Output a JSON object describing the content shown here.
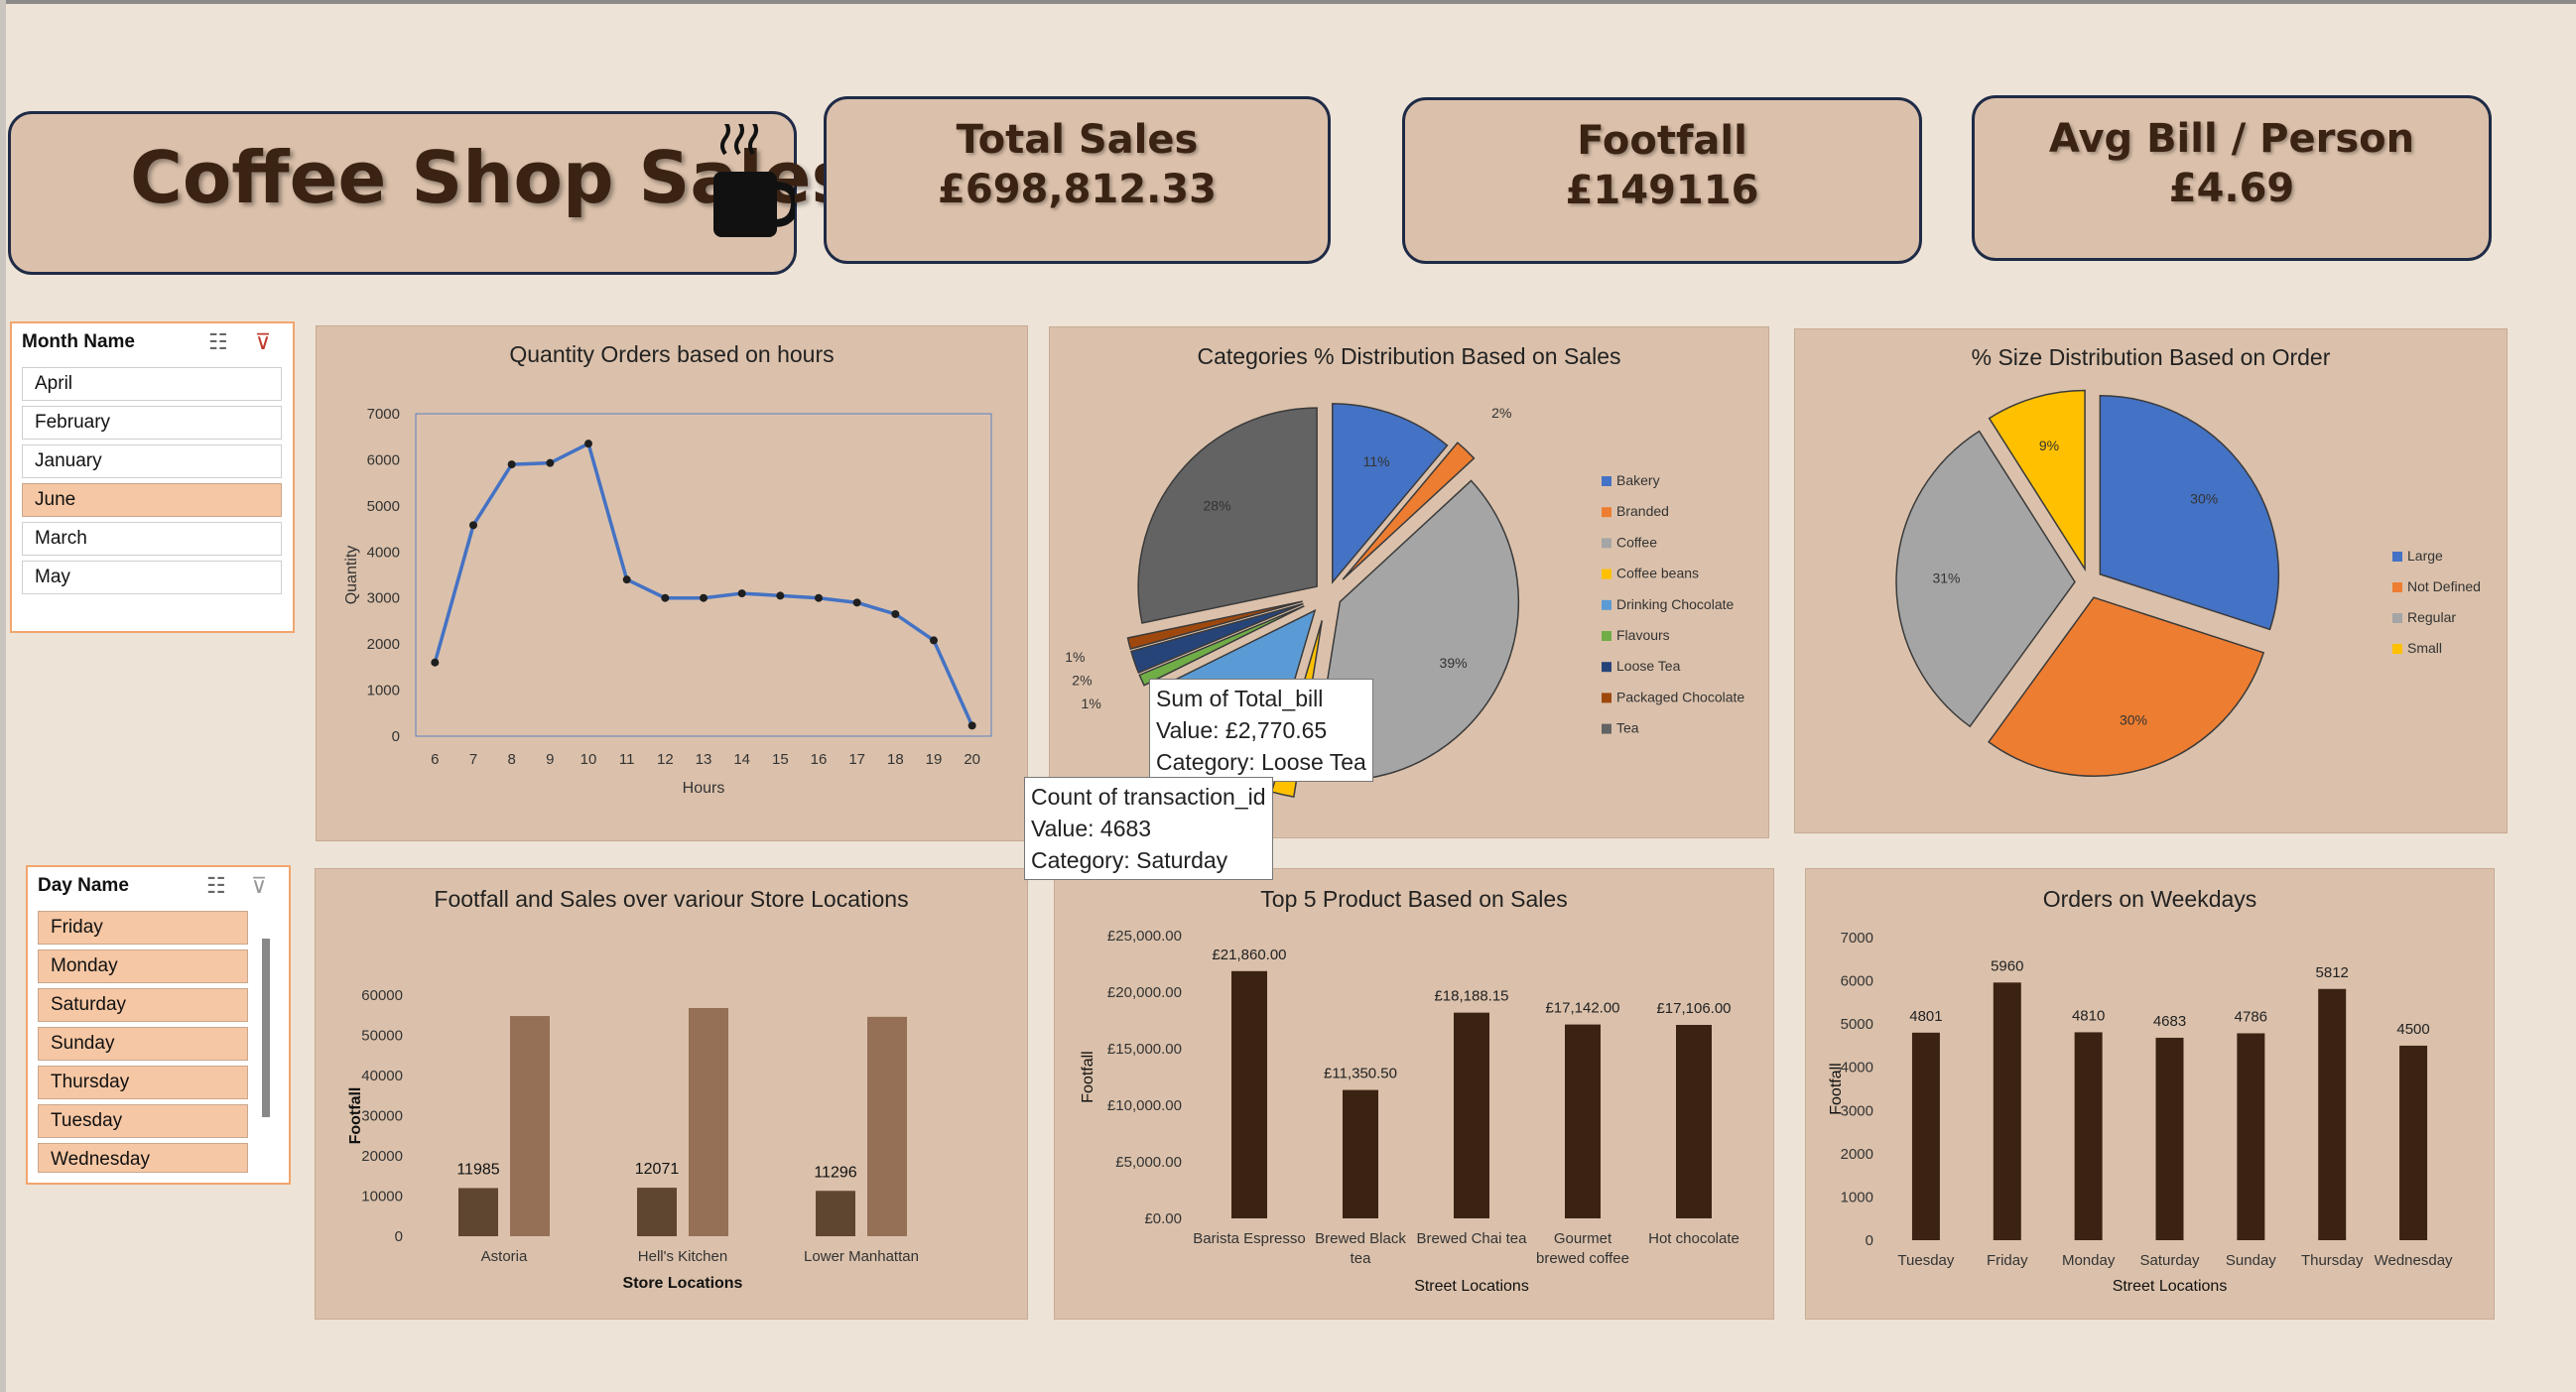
{
  "header": {
    "title": "Coffee Shop Sales",
    "kpis": [
      {
        "label": "Total Sales",
        "value": "£698,812.33"
      },
      {
        "label": "Footfall",
        "value": "£149116"
      },
      {
        "label": "Avg Bill / Person",
        "value": "£4.69"
      }
    ]
  },
  "slicers": {
    "month": {
      "title": "Month Name",
      "items": [
        "April",
        "February",
        "January",
        "June",
        "March",
        "May"
      ],
      "selected": "June"
    },
    "day": {
      "title": "Day Name",
      "items": [
        "Friday",
        "Monday",
        "Saturday",
        "Sunday",
        "Thursday",
        "Tuesday",
        "Wednesday"
      ]
    }
  },
  "tooltips": [
    {
      "lines": [
        "Sum of Total_bill",
        "Value: £2,770.65",
        "Category: Loose Tea"
      ]
    },
    {
      "lines": [
        "Count of transaction_id",
        "Value: 4683",
        "Category: Saturday"
      ]
    }
  ],
  "colors": {
    "background": "#ede3d7",
    "card": "#dbc1ab",
    "accent_dark": "#3b2314",
    "line": "#4472c4",
    "bar_dark": "#3b2314",
    "bar_mid": "#5f4630",
    "bar_light": "#957056"
  },
  "chart_data": [
    {
      "type": "line",
      "title": "Quantity Orders based on hours",
      "xlabel": "Hours",
      "ylabel": "Quantity",
      "x": [
        6,
        7,
        8,
        9,
        10,
        11,
        12,
        13,
        14,
        15,
        16,
        17,
        18,
        19,
        20
      ],
      "values": [
        1600,
        4580,
        5900,
        5930,
        6350,
        3400,
        3000,
        3000,
        3100,
        3050,
        3000,
        2900,
        2650,
        2080,
        230
      ],
      "ylim": [
        0,
        7000
      ],
      "yticks": [
        "0",
        "1000",
        "2000",
        "3000",
        "4000",
        "5000",
        "6000",
        "7000"
      ]
    },
    {
      "type": "pie",
      "title": "Categories % Distribution Based on Sales",
      "categories": [
        "Bakery",
        "Branded",
        "Coffee",
        "Coffee beans",
        "Drinking Chocolate",
        "Flavours",
        "Loose Tea",
        "Packaged Chocolate",
        "Tea"
      ],
      "values": [
        11,
        2,
        39,
        2,
        13,
        1,
        2,
        1,
        28
      ],
      "labels": [
        "11%",
        "2%",
        "39%",
        "",
        "",
        "1%",
        "2%",
        "1%",
        "28%"
      ],
      "colors": [
        "#4472c4",
        "#ed7d31",
        "#a5a5a5",
        "#ffc000",
        "#5b9bd5",
        "#70ad47",
        "#264478",
        "#9e480e",
        "#636363"
      ],
      "legend": "right"
    },
    {
      "type": "pie",
      "title": "% Size Distribution Based on Order",
      "categories": [
        "Large",
        "Not Defined",
        "Regular",
        "Small"
      ],
      "values": [
        30,
        30,
        31,
        9
      ],
      "labels": [
        "30%",
        "30%",
        "31%",
        "9%"
      ],
      "colors": [
        "#4472c4",
        "#ed7d31",
        "#a5a5a5",
        "#ffc000"
      ],
      "legend": "right"
    },
    {
      "type": "bar",
      "title": "Footfall and Sales over variour Store Locations",
      "xlabel": "Store Locations",
      "ylabel": "Footfall",
      "categories": [
        "Astoria",
        "Hell's Kitchen",
        "Lower Manhattan"
      ],
      "series": [
        {
          "values": [
            11985,
            12071,
            11296
          ],
          "labels": [
            "11985",
            "12071",
            "11296"
          ]
        },
        {
          "values": [
            54800,
            56800,
            54600
          ]
        }
      ],
      "ylim": [
        0,
        60000
      ],
      "yticks": [
        "0",
        "10000",
        "20000",
        "30000",
        "40000",
        "50000",
        "60000"
      ]
    },
    {
      "type": "bar",
      "title": "Top 5 Product Based on Sales",
      "xlabel": "Street Locations",
      "ylabel": "Footfall",
      "categories": [
        "Barista Espresso",
        "Brewed Black tea",
        "Brewed Chai tea",
        "Gourmet brewed coffee",
        "Hot chocolate"
      ],
      "values": [
        21860,
        11350.5,
        18188.15,
        17142,
        17106
      ],
      "labels": [
        "£21,860.00",
        "£11,350.50",
        "£18,188.15",
        "£17,142.00",
        "£17,106.00"
      ],
      "ylim": [
        0,
        25000
      ],
      "yticks": [
        "£0.00",
        "£5,000.00",
        "£10,000.00",
        "£15,000.00",
        "£20,000.00",
        "£25,000.00"
      ]
    },
    {
      "type": "bar",
      "title": "Orders on Weekdays",
      "xlabel": "Street Locations",
      "ylabel": "Footfall",
      "categories": [
        "Tuesday",
        "Friday",
        "Monday",
        "Saturday",
        "Sunday",
        "Thursday",
        "Wednesday"
      ],
      "values": [
        4801,
        5960,
        4810,
        4683,
        4786,
        5812,
        4500
      ],
      "labels": [
        "4801",
        "5960",
        "4810",
        "4683",
        "4786",
        "5812",
        "4500"
      ],
      "ylim": [
        0,
        7000
      ],
      "yticks": [
        "0",
        "1000",
        "2000",
        "3000",
        "4000",
        "5000",
        "6000",
        "7000"
      ]
    }
  ]
}
